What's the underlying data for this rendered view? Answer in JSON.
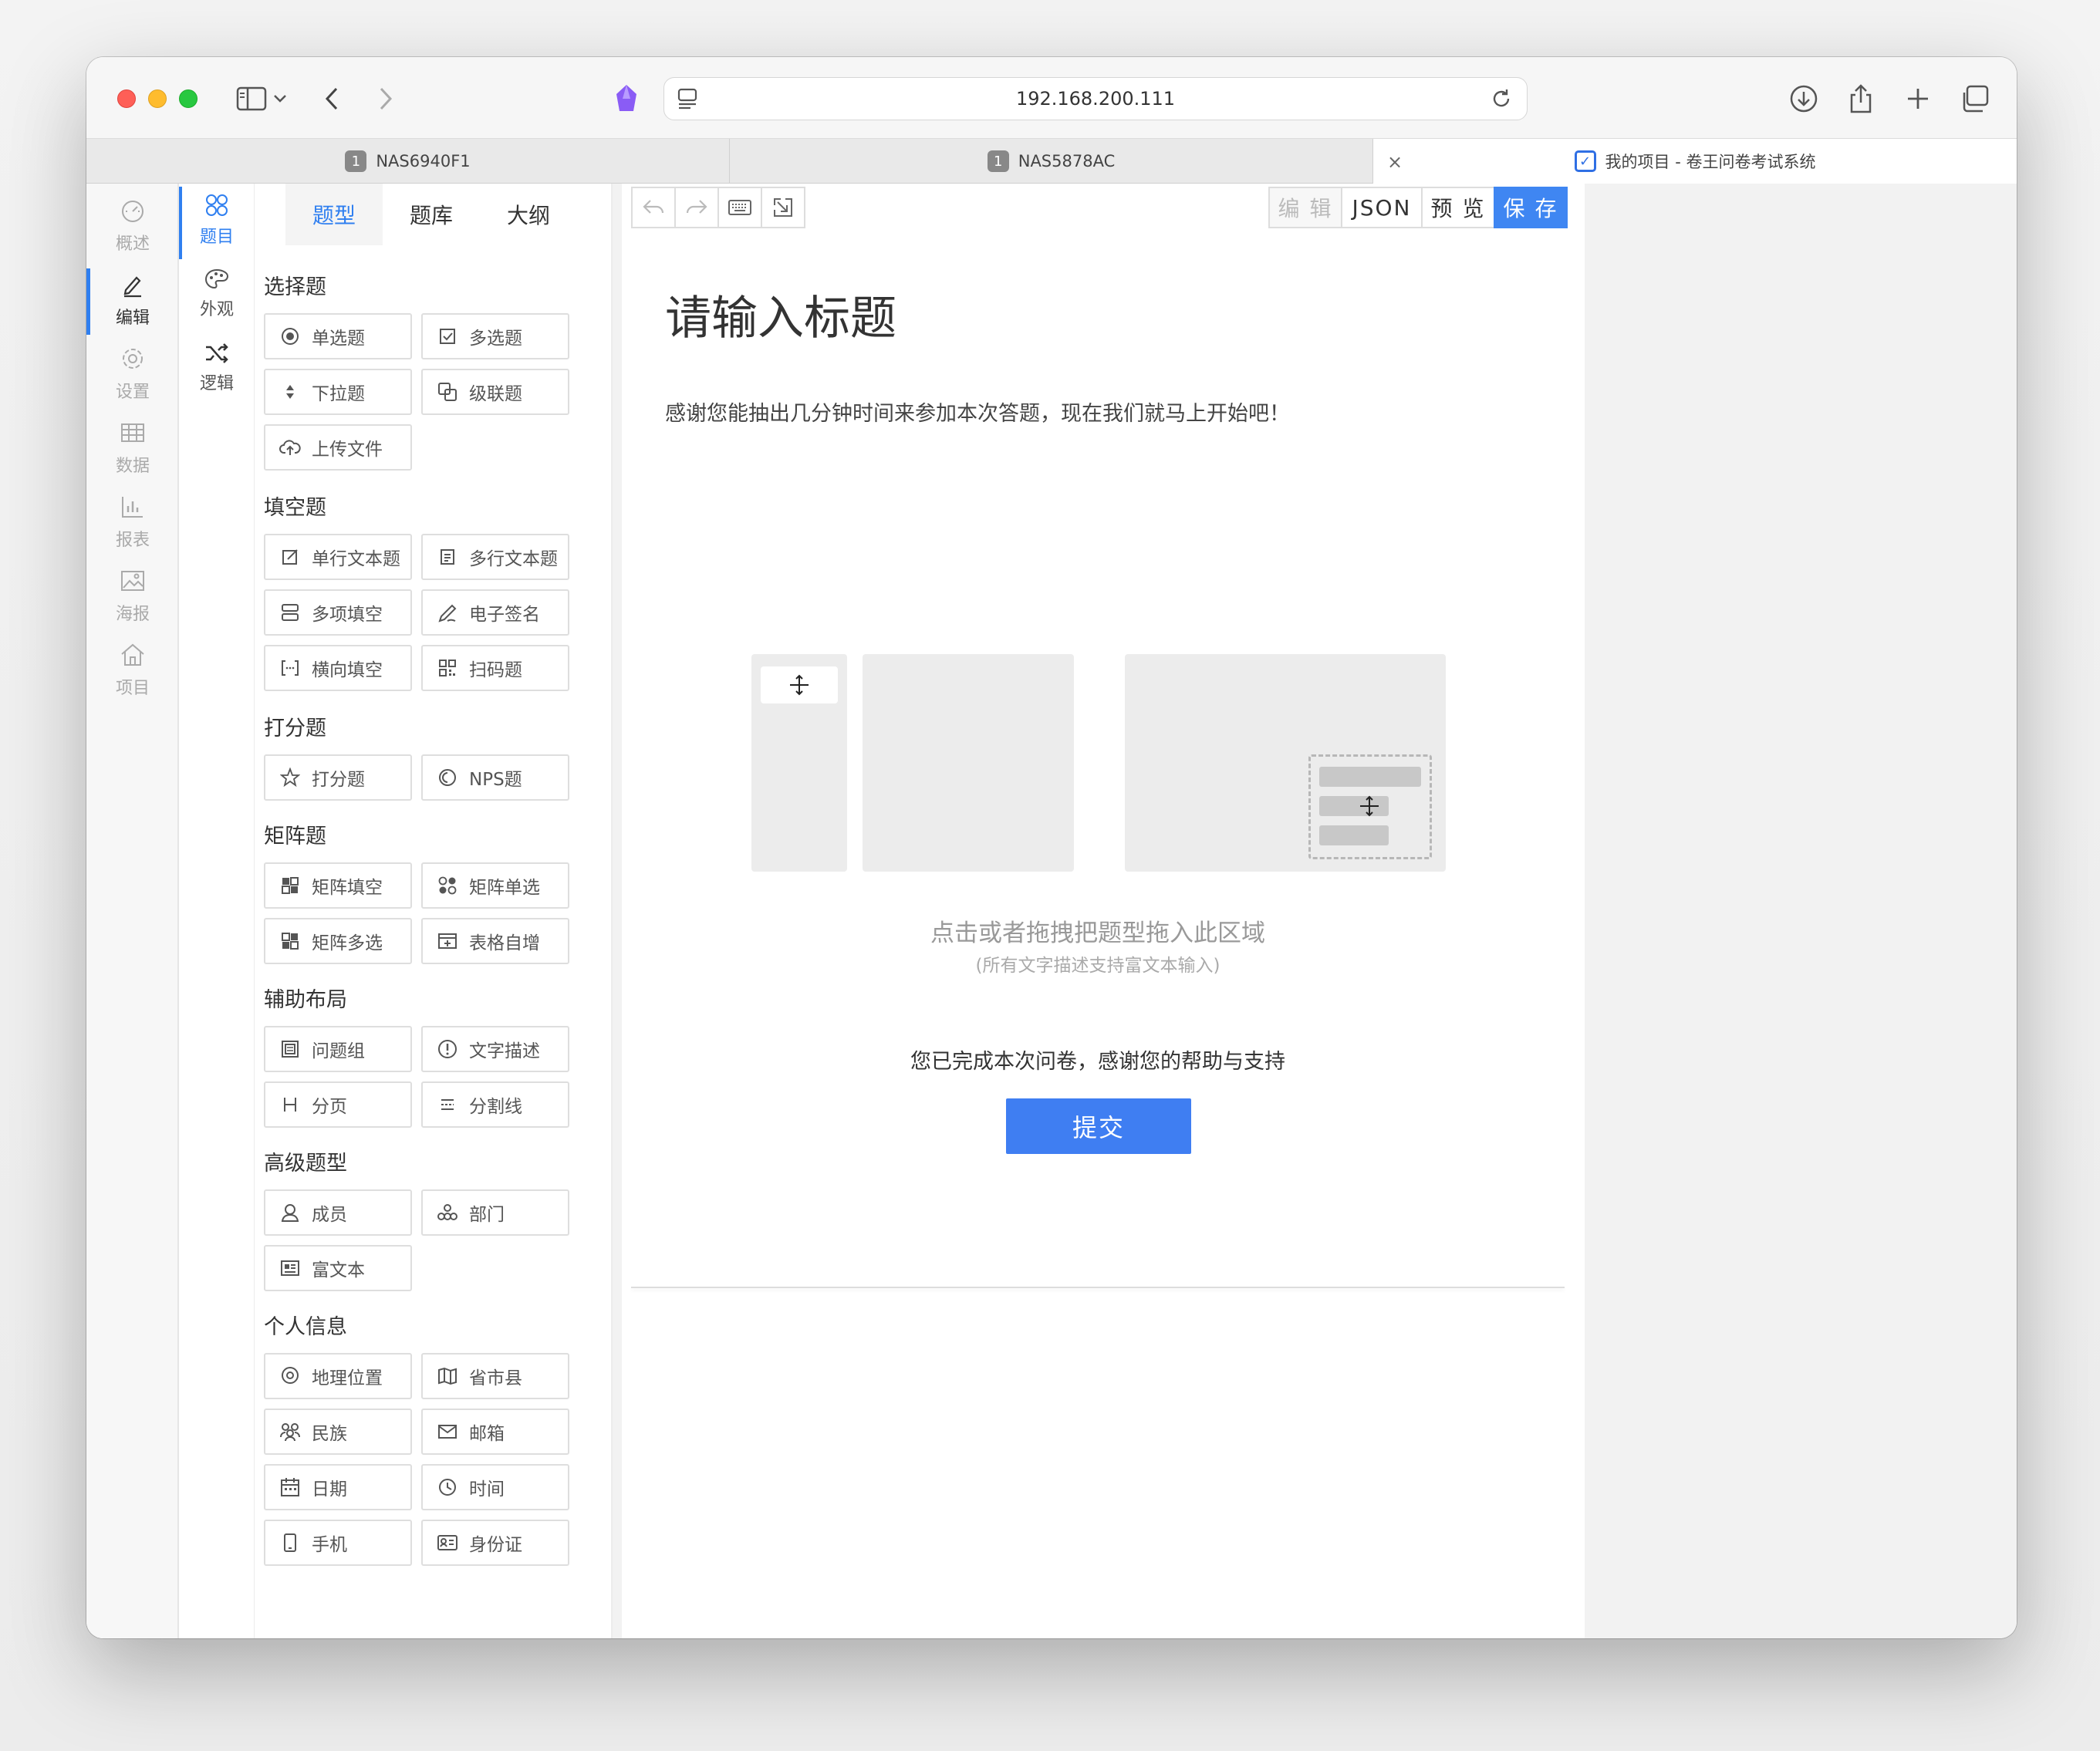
{
  "browser": {
    "url": "192.168.200.111",
    "tabs": [
      {
        "badge": "1",
        "label": "NAS6940F1"
      },
      {
        "badge": "1",
        "label": "NAS5878AC"
      },
      {
        "label": "我的项目 - 卷王问卷考试系统"
      }
    ]
  },
  "nav1": {
    "items": [
      {
        "label": "概述",
        "icon": "dashboard-icon"
      },
      {
        "label": "编辑",
        "icon": "edit-icon"
      },
      {
        "label": "设置",
        "icon": "gear-icon"
      },
      {
        "label": "数据",
        "icon": "table-icon"
      },
      {
        "label": "报表",
        "icon": "bar-chart-icon"
      },
      {
        "label": "海报",
        "icon": "image-icon"
      },
      {
        "label": "项目",
        "icon": "home-icon"
      }
    ]
  },
  "nav2": {
    "items": [
      {
        "label": "题目",
        "icon": "questions-icon"
      },
      {
        "label": "外观",
        "icon": "palette-icon"
      },
      {
        "label": "逻辑",
        "icon": "shuffle-icon"
      }
    ]
  },
  "palette": {
    "tabs": [
      "题型",
      "题库",
      "大纲"
    ],
    "sections": {
      "choice": "选择题",
      "fill": "填空题",
      "score": "打分题",
      "matrix": "矩阵题",
      "layout": "辅助布局",
      "advanced": "高级题型",
      "personal": "个人信息"
    },
    "buttons": {
      "radio": "单选题",
      "checkbox": "多选题",
      "select": "下拉题",
      "cascade": "级联题",
      "upload": "上传文件",
      "single_text": "单行文本题",
      "multi_text": "多行文本题",
      "multi_fill": "多项填空",
      "signature": "电子签名",
      "horizontal_fill": "横向填空",
      "barcode": "扫码题",
      "rate": "打分题",
      "nps": "NPS题",
      "matrix_fill": "矩阵填空",
      "matrix_radio": "矩阵单选",
      "matrix_checkbox": "矩阵多选",
      "table_auto": "表格自增",
      "question_group": "问题组",
      "text_desc": "文字描述",
      "pagination": "分页",
      "divider": "分割线",
      "member": "成员",
      "department": "部门",
      "rich_text": "富文本",
      "location": "地理位置",
      "province": "省市县",
      "ethnicity": "民族",
      "email": "邮箱",
      "date": "日期",
      "time": "时间",
      "phone": "手机",
      "id_card": "身份证"
    }
  },
  "toolbar": {
    "edit": "编 辑",
    "json": "JSON",
    "preview": "预 览",
    "save": "保 存"
  },
  "survey": {
    "title": "请输入标题",
    "description": "感谢您能抽出几分钟时间来参加本次答题，现在我们就马上开始吧！",
    "drop_hint": "点击或者拖拽把题型拖入此区域",
    "drop_sub": "(所有文字描述支持富文本输入)",
    "finish_text": "您已完成本次问卷，感谢您的帮助与支持",
    "submit": "提交"
  }
}
